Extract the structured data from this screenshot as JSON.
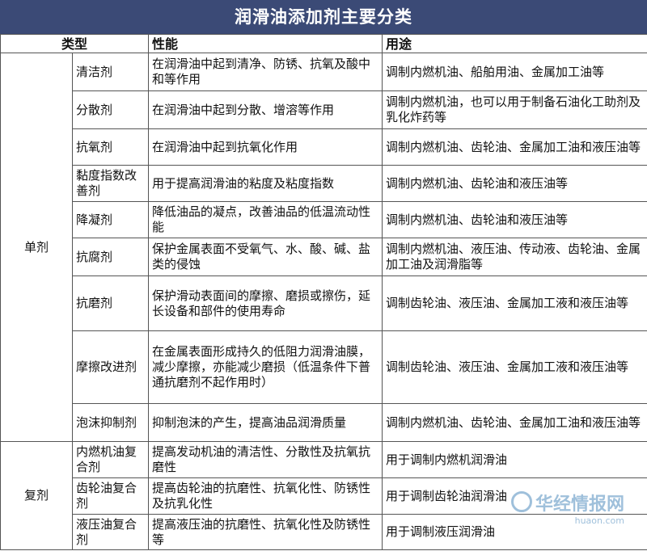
{
  "title": "润滑油添加剂主要分类",
  "headers": {
    "type": "类型",
    "property": "性能",
    "usage": "用途"
  },
  "groups": [
    {
      "category": "单剂",
      "rows": [
        {
          "name": "清洁剂",
          "property": "在润滑油中起到清净、防锈、抗氧及酸中和等作用",
          "usage": "调制内燃机油、船舶用油、金属加工油等"
        },
        {
          "name": "分散剂",
          "property": "在润滑油中起到分散、增溶等作用",
          "usage": "调制内燃机油，也可以用于制备石油化工助剂及乳化炸药等"
        },
        {
          "name": "抗氧剂",
          "property": "在润滑油中起到抗氧化作用",
          "usage": "调制内燃机油、齿轮油、金属加工油和液压油等"
        },
        {
          "name": "黏度指数改善剂",
          "property": "用于提高润滑油的粘度及粘度指数",
          "usage": "调制内燃机油、齿轮油和液压油等"
        },
        {
          "name": "降凝剂",
          "property": "降低油品的凝点，改善油品的低温流动性能",
          "usage": "调制内燃机油、齿轮油和液压油等"
        },
        {
          "name": "抗腐剂",
          "property": "保护金属表面不受氧气、水、酸、碱、盐类的侵蚀",
          "usage": "调制内燃机油、液压油、传动液、齿轮油、金属加工油及润滑脂等"
        },
        {
          "name": "抗磨剂",
          "property": "保护滑动表面间的摩擦、磨损或擦伤，延长设备和部件的使用寿命",
          "usage": "调制齿轮油、液压油、金属加工液和液压油等"
        },
        {
          "name": "摩擦改进剂",
          "property": "在金属表面形成持久的低阻力润滑油膜，减少摩擦，亦能减少磨损（低温条件下普通抗磨剂不起作用时）",
          "usage": "调制齿轮油、液压油、金属加工液和液压油等"
        },
        {
          "name": "泡沫抑制剂",
          "property": "抑制泡沫的产生，提高油品润滑质量",
          "usage": "调制内燃机油、齿轮油、金属加工油和液压油等"
        }
      ]
    },
    {
      "category": "复剂",
      "rows": [
        {
          "name": "内燃机油复合剂",
          "property": "提高发动机油的清洁性、分散性及抗氧抗磨性",
          "usage": "用于调制内燃机润滑油"
        },
        {
          "name": "齿轮油复合剂",
          "property": "提高齿轮油的抗磨性、抗氧化性、防锈性及抗乳化性",
          "usage": "用于调制齿轮油润滑油"
        },
        {
          "name": "液压油复合剂",
          "property": "提高液压油的抗磨性、抗氧化性及防锈性等",
          "usage": "用于调制液压润滑油"
        }
      ]
    }
  ],
  "watermark": {
    "brand": "华经情报网",
    "url": "huaon.com",
    "icon": "huaon-logo-icon",
    "color": "#508cbe"
  }
}
